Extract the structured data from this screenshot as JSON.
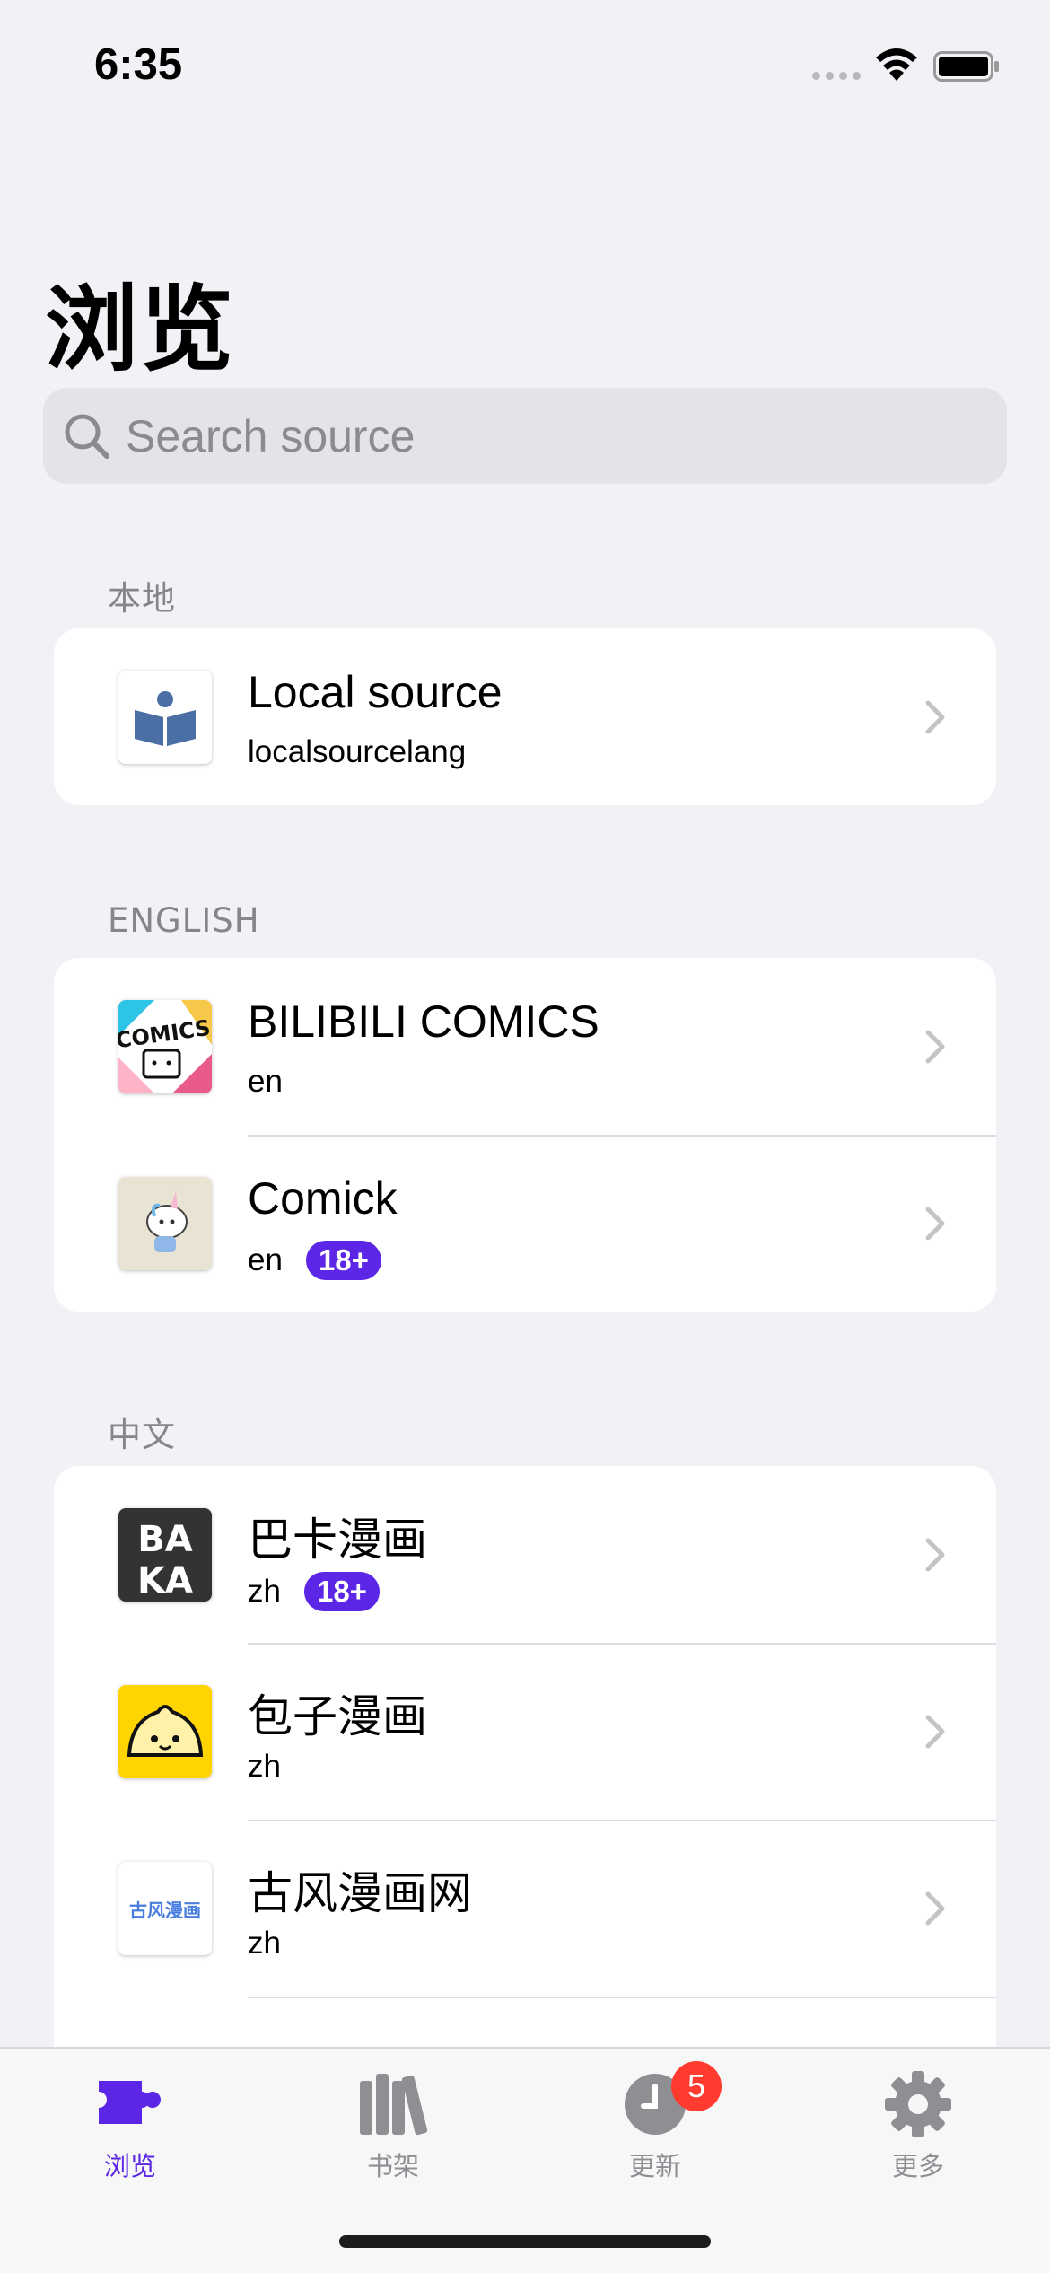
{
  "status_bar": {
    "time": "6:35"
  },
  "title": "浏览",
  "search": {
    "placeholder": "Search source",
    "value": ""
  },
  "sections": [
    {
      "header": "本地",
      "items": [
        {
          "title": "Local source",
          "lang": "localsourcelang",
          "badge": "",
          "icon": "local-source-icon"
        }
      ]
    },
    {
      "header": "ENGLISH",
      "items": [
        {
          "title": "BILIBILI COMICS",
          "lang": "en",
          "badge": "",
          "icon": "bilibili-comics-icon"
        },
        {
          "title": "Comick",
          "lang": "en",
          "badge": "18+",
          "icon": "comick-icon"
        }
      ]
    },
    {
      "header": "中文",
      "items": [
        {
          "title": "巴卡漫画",
          "lang": "zh",
          "badge": "18+",
          "icon": "baka-icon"
        },
        {
          "title": "包子漫画",
          "lang": "zh",
          "badge": "",
          "icon": "baozi-icon"
        },
        {
          "title": "古风漫画网",
          "lang": "zh",
          "badge": "",
          "icon": "gufeng-icon",
          "icon_text": "古风漫画"
        }
      ]
    }
  ],
  "tab_bar": {
    "tabs": [
      {
        "label": "浏览",
        "icon": "puzzle-icon",
        "active": true
      },
      {
        "label": "书架",
        "icon": "books-icon",
        "active": false
      },
      {
        "label": "更新",
        "icon": "clock-icon",
        "active": false,
        "badge": "5"
      },
      {
        "label": "更多",
        "icon": "gear-icon",
        "active": false
      }
    ]
  },
  "colors": {
    "accent": "#5b26e6",
    "background": "#f2f1f6",
    "badge_red": "#ff3b30"
  }
}
